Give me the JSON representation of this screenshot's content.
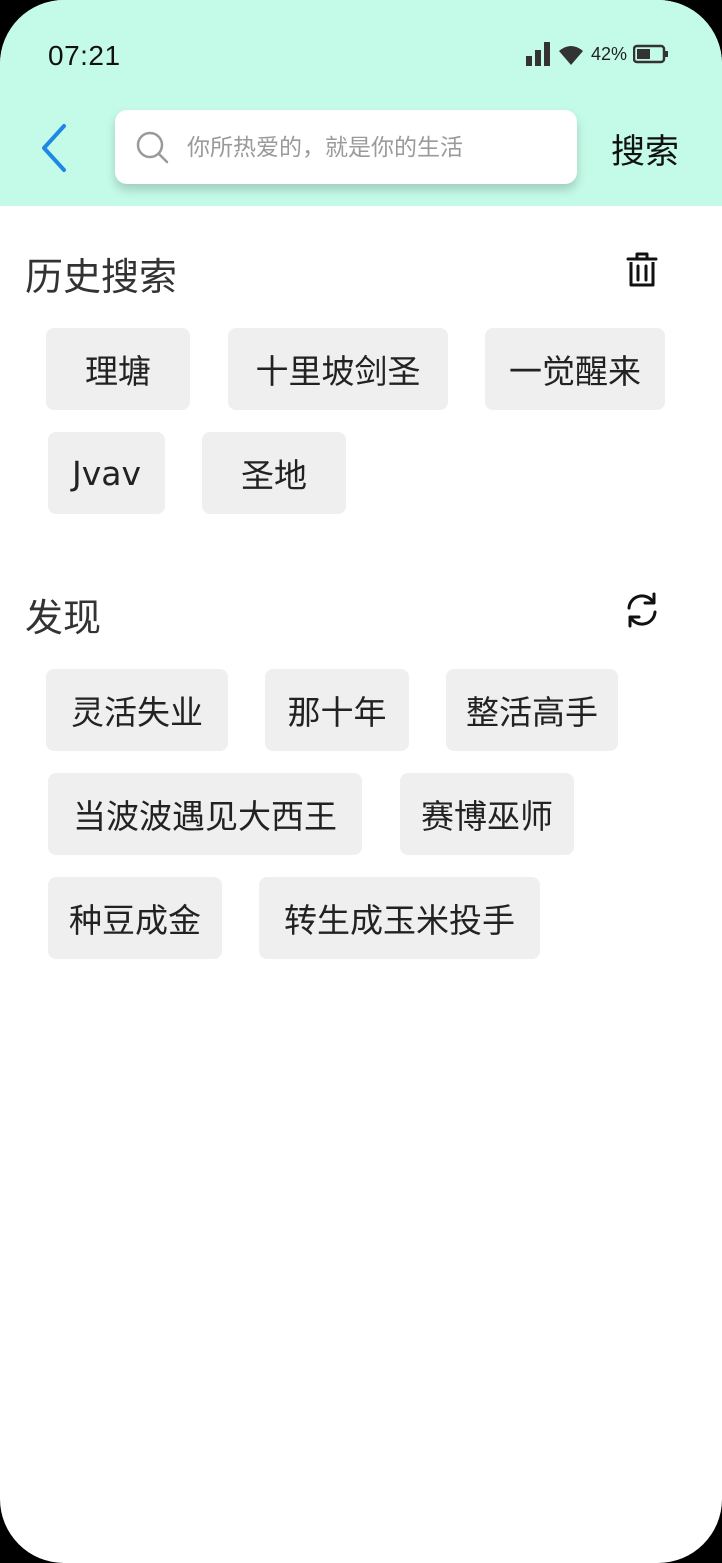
{
  "status_bar": {
    "time": "07:21",
    "battery_text": "42%",
    "battery_level": 0.42
  },
  "search": {
    "placeholder": "你所热爱的，就是你的生活",
    "button_label": "搜索"
  },
  "history": {
    "title": "历史搜索",
    "items": [
      "理塘",
      "十里坡剑圣",
      "一觉醒来",
      "Jvav",
      "圣地"
    ]
  },
  "discover": {
    "title": "发现",
    "items": [
      "灵活失业",
      "那十年",
      "整活高手",
      "当波波遇见大西王",
      "赛博巫师",
      "种豆成金",
      "转生成玉米投手"
    ]
  },
  "colors": {
    "header_bg": "#c4fbe8",
    "back_arrow": "#1e88e5",
    "chip_bg": "#efefef"
  },
  "icons": {
    "back": "chevron-left-icon",
    "search": "search-icon",
    "delete": "trash-icon",
    "refresh": "refresh-icon"
  }
}
